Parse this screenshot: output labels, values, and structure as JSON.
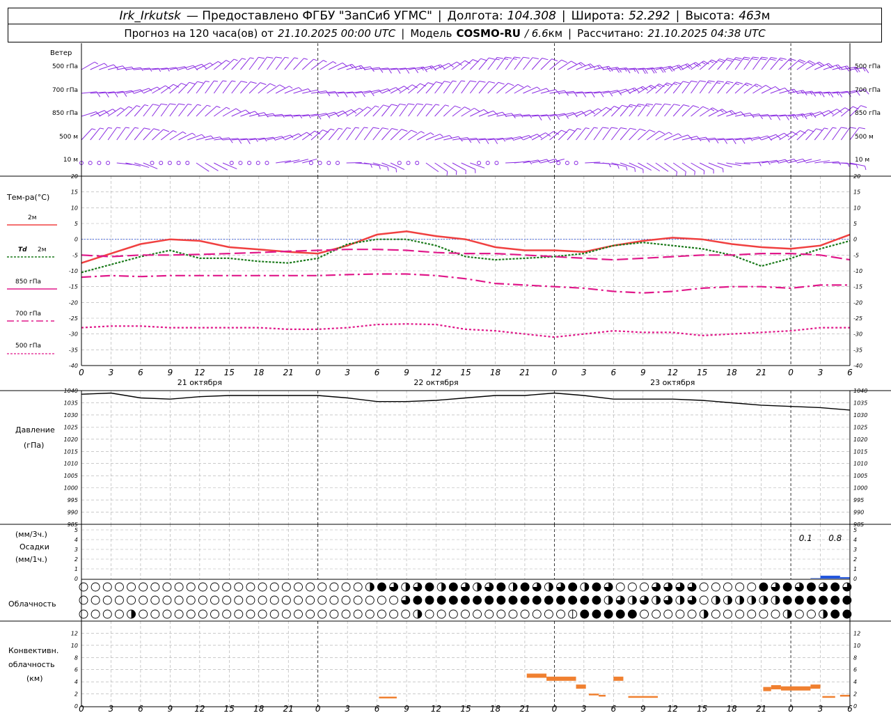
{
  "header": {
    "station": "Irk_Irkutsk",
    "provider": "— Предоставлено ФГБУ \"ЗапСиб УГМС\"",
    "lon_label": "Долгота:",
    "lon": "104.308",
    "lat_label": "Широта:",
    "lat": "52.292",
    "alt_label": "Высота:",
    "alt": "463",
    "alt_unit": "м",
    "forecast_label": "Прогноз на 120 часа(ов) от",
    "forecast_start": "21.10.2025 00:00 UTC",
    "model_label": "Модель",
    "model": "COSMO-RU",
    "model_res": "/ 6.6",
    "model_res_unit": "км",
    "computed_label": "Рассчитано:",
    "computed": "21.10.2025 04:38 UTC"
  },
  "chart_data": [
    {
      "type": "wind-barbs",
      "title": "Ветер",
      "levels": [
        "500 гПа",
        "700 гПа",
        "850 гПа",
        "500 м",
        "10 м"
      ],
      "color": "#8a2be2",
      "speed_by_day": {
        "500 гПа": [
          8,
          14,
          22
        ],
        "700 гПа": [
          10,
          12,
          16
        ],
        "850 гПа": [
          10,
          12,
          14
        ],
        "500 м": [
          8,
          10,
          12
        ],
        "10 м": [
          2,
          4,
          6
        ]
      }
    },
    {
      "type": "line",
      "title": "Тем-ра(°C)",
      "ylim": [
        -40,
        20
      ],
      "yticks": [
        20,
        15,
        10,
        5,
        0,
        -5,
        -10,
        -15,
        -20,
        -25,
        -30,
        -35,
        -40
      ],
      "x_hours": [
        0,
        3,
        6,
        9,
        12,
        15,
        18,
        21,
        24,
        27,
        30,
        33,
        36,
        39,
        42,
        45,
        48,
        51,
        54,
        57,
        60,
        63,
        66,
        69,
        72,
        75,
        78
      ],
      "series": [
        {
          "name": "2м",
          "color": "#f04040",
          "dash": "",
          "values": [
            -7.5,
            -4.5,
            -1.5,
            0,
            -0.5,
            -2.5,
            -3.2,
            -4,
            -4.5,
            -2,
            1.5,
            2.5,
            1,
            0,
            -2.5,
            -3.5,
            -3.5,
            -4,
            -2,
            -0.5,
            0.5,
            0,
            -1.5,
            -2.5,
            -3,
            -2,
            1.5
          ]
        },
        {
          "name": "Td 2м",
          "color": "#1a7a1a",
          "dash": "3,2",
          "values": [
            -10.5,
            -8,
            -5.5,
            -3.5,
            -6,
            -6,
            -7,
            -7.5,
            -6,
            -1.5,
            0,
            0,
            -2,
            -5.5,
            -6.5,
            -6,
            -5.5,
            -4.5,
            -2,
            -1,
            -2,
            -3,
            -5,
            -8.5,
            -6,
            -3,
            -0.5
          ]
        },
        {
          "name": "850 гПа",
          "color": "#e0188a",
          "dash": "16,6",
          "values": [
            -5,
            -5.5,
            -5,
            -5,
            -4.8,
            -4.5,
            -4.2,
            -3.8,
            -3.5,
            -3.2,
            -3.2,
            -3.5,
            -4.2,
            -4.5,
            -4.5,
            -5,
            -5.5,
            -6,
            -6.5,
            -6,
            -5.5,
            -5,
            -5,
            -4.5,
            -4.5,
            -5,
            -6.5
          ]
        },
        {
          "name": "700 гПа",
          "color": "#e0188a",
          "dash": "14,5,3,5",
          "values": [
            -12,
            -11.5,
            -11.8,
            -11.5,
            -11.5,
            -11.5,
            -11.5,
            -11.5,
            -11.5,
            -11.2,
            -11,
            -11,
            -11.5,
            -12.5,
            -14,
            -14.5,
            -15,
            -15.5,
            -16.5,
            -17,
            -16.5,
            -15.5,
            -15,
            -15,
            -15.5,
            -14.5,
            -14.5
          ]
        },
        {
          "name": "500 гПа",
          "color": "#e0188a",
          "dash": "3,3",
          "values": [
            -28,
            -27.5,
            -27.5,
            -28,
            -28,
            -28,
            -28,
            -28.5,
            -28.5,
            -28,
            -27,
            -26.8,
            -27,
            -28.5,
            -29,
            -30,
            -31,
            -30,
            -29,
            -29.5,
            -29.5,
            -30.5,
            -30,
            -29.5,
            -29,
            -28,
            -28
          ]
        }
      ]
    },
    {
      "type": "line",
      "title": "Давление",
      "units": "(гПа)",
      "ylim": [
        985,
        1040
      ],
      "yticks": [
        1040,
        1035,
        1030,
        1025,
        1020,
        1015,
        1010,
        1005,
        1000,
        995,
        990,
        985
      ],
      "x_hours": [
        0,
        3,
        6,
        9,
        12,
        15,
        18,
        21,
        24,
        27,
        30,
        33,
        36,
        39,
        42,
        45,
        48,
        51,
        54,
        57,
        60,
        63,
        66,
        69,
        72,
        75,
        78
      ],
      "series": [
        {
          "name": "",
          "color": "#000000",
          "values": [
            1038.5,
            1039,
            1037,
            1036.5,
            1037.5,
            1038,
            1038,
            1038,
            1038,
            1037,
            1035.5,
            1035.5,
            1036,
            1037,
            1038,
            1038,
            1039,
            1038,
            1036.5,
            1036.5,
            1036.5,
            1036,
            1035,
            1034,
            1033.5,
            1033,
            1032
          ]
        }
      ]
    },
    {
      "type": "bar",
      "title": "Осадки",
      "units_top": "(мм/3ч.)",
      "units_bottom": "(мм/1ч.)",
      "ylim": [
        0,
        5
      ],
      "yticks": [
        5,
        4,
        3,
        2,
        1,
        0
      ],
      "bars": [
        {
          "from_h": 74,
          "to_h": 75,
          "value": 0.05
        },
        {
          "from_h": 75,
          "to_h": 77,
          "value": 0.3
        },
        {
          "from_h": 77,
          "to_h": 78,
          "value": 0.15
        }
      ],
      "annotations": [
        {
          "hour": 73.5,
          "text": "0.1"
        },
        {
          "hour": 76.5,
          "text": "0.8"
        }
      ]
    },
    {
      "type": "cloud-symbols",
      "title": "Облачность",
      "rows": [
        "upper",
        "middle",
        "lower"
      ]
    },
    {
      "type": "bar",
      "title": "Конвективн. облачность",
      "units": "(км)",
      "ylim": [
        0,
        14
      ],
      "yticks": [
        12,
        10,
        8,
        6,
        4,
        2,
        0
      ],
      "color": "#f08030",
      "segments": [
        {
          "from_h": 30.2,
          "to_h": 32,
          "value": 1.2
        },
        {
          "from_h": 45.2,
          "to_h": 47.2,
          "value": 5
        },
        {
          "from_h": 47.2,
          "to_h": 50.2,
          "value": 4.5
        },
        {
          "from_h": 50.2,
          "to_h": 51.2,
          "value": 3.2
        },
        {
          "from_h": 51.5,
          "to_h": 52.5,
          "value": 1.7
        },
        {
          "from_h": 52.5,
          "to_h": 53.2,
          "value": 1.5
        },
        {
          "from_h": 54,
          "to_h": 55,
          "value": 4.5
        },
        {
          "from_h": 55.5,
          "to_h": 58.5,
          "value": 1.3
        },
        {
          "from_h": 69.2,
          "to_h": 70,
          "value": 2.8
        },
        {
          "from_h": 70,
          "to_h": 71,
          "value": 3.1
        },
        {
          "from_h": 71,
          "to_h": 74,
          "value": 2.9
        },
        {
          "from_h": 74,
          "to_h": 75,
          "value": 3.2
        },
        {
          "from_h": 75.2,
          "to_h": 76.5,
          "value": 1.3
        },
        {
          "from_h": 77,
          "to_h": 78,
          "value": 1.5
        }
      ]
    }
  ],
  "x_axis": {
    "hour_labels": [
      "0",
      "3",
      "6",
      "9",
      "12",
      "15",
      "18",
      "21",
      "0",
      "3",
      "6",
      "9",
      "12",
      "15",
      "18",
      "21",
      "0",
      "3",
      "6",
      "9",
      "12",
      "15",
      "18",
      "21",
      "0",
      "3",
      "6"
    ],
    "day_labels": [
      "21 октября",
      "22 октября",
      "23 октября"
    ]
  },
  "legend": {
    "t2m": "2м",
    "td_sym": "Td",
    "td_lvl": "2м",
    "t850": "850 гПа",
    "t700": "700 гПа",
    "t500": "500 гПа"
  }
}
